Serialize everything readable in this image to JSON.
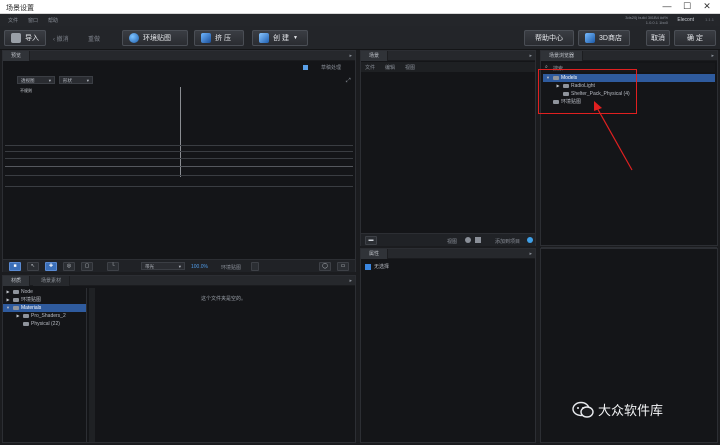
{
  "window": {
    "title": "场景设置",
    "minimize": "—",
    "maximize": "☐",
    "close": "✕"
  },
  "menu": {
    "file": "文件",
    "window": "窗口",
    "help": "帮助",
    "build_info_1": "3ds20j build 3ll1B4  ##%",
    "build_info_2": "1.0.0.1 1bo0",
    "user": "Elecont",
    "version": "1.1.1"
  },
  "toolbar": {
    "import": "导入",
    "undo": "撤消",
    "redo": "重做",
    "env_map": "环境贴图",
    "extrude": "挤 压",
    "create": "创 建",
    "help_center": "帮助中心",
    "store": "3D商店",
    "cancel": "取消",
    "ok": "确 定"
  },
  "preview": {
    "tab": "预览",
    "scene_viewer": "草稿处理",
    "dropdown1": "透视图",
    "dropdown2": "形状",
    "overlay": "不规则",
    "bottom": {
      "display_mode": "带光",
      "zoom": "100.0%",
      "env_map": "环境贴图"
    }
  },
  "scene": {
    "tab": "场景",
    "menu_file": "文件",
    "menu_edit": "编辑",
    "menu_view": "视图",
    "bottom_view": "视图",
    "bottom_add": "添加到项目"
  },
  "properties": {
    "tab": "属性",
    "item": "无选择"
  },
  "library": {
    "tab": "场景浏览器",
    "search": "搜索",
    "items": [
      {
        "label": "Models",
        "level": 0,
        "caret": "▼",
        "selected": true
      },
      {
        "label": "RadioLight",
        "level": 1,
        "caret": "▶",
        "selected": false
      },
      {
        "label": "Shelter_Pack_Physical (4)",
        "level": 1,
        "caret": "",
        "selected": false
      },
      {
        "label": "环境贴图",
        "level": 0,
        "caret": "",
        "selected": false
      }
    ]
  },
  "assets": {
    "tab_1": "材质",
    "tab_2": "场景素材",
    "empty_text": "这个文件夹是空的。",
    "tree": [
      {
        "label": "Node",
        "level": 0,
        "caret": "▶",
        "selected": false
      },
      {
        "label": "环境贴图",
        "level": 0,
        "caret": "▶",
        "selected": false
      },
      {
        "label": "Materials",
        "level": 0,
        "caret": "▼",
        "selected": true
      },
      {
        "label": "Pro_Shaders_2",
        "level": 1,
        "caret": "▶",
        "selected": false
      },
      {
        "label": "Physical (22)",
        "level": 1,
        "caret": "",
        "selected": false
      }
    ]
  },
  "watermark": {
    "text": "大众软件库"
  },
  "colors": {
    "accent_blue": "#2f5b9e",
    "annotation_red": "#e02020",
    "panel_bg": "#141518"
  }
}
